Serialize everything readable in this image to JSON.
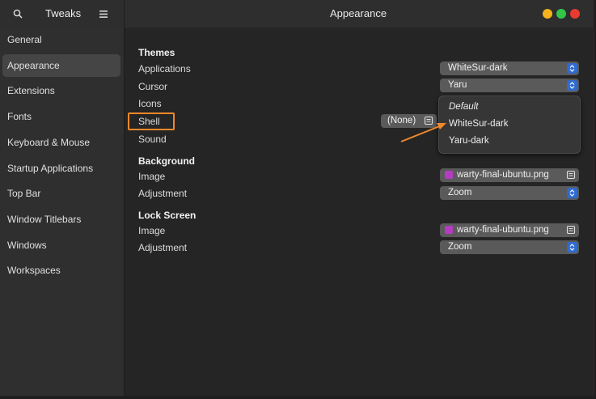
{
  "header": {
    "app_title": "Tweaks",
    "page_title": "Appearance",
    "window_controls": {
      "minimize_color": "#f5b31c",
      "maximize_color": "#33c748",
      "close_color": "#e93b30"
    }
  },
  "sidebar": {
    "items": [
      {
        "label": "General"
      },
      {
        "label": "Appearance",
        "active": true
      },
      {
        "label": "Extensions"
      },
      {
        "label": "Fonts"
      },
      {
        "label": "Keyboard & Mouse"
      },
      {
        "label": "Startup Applications"
      },
      {
        "label": "Top Bar"
      },
      {
        "label": "Window Titlebars"
      },
      {
        "label": "Windows"
      },
      {
        "label": "Workspaces"
      }
    ]
  },
  "themes": {
    "heading": "Themes",
    "applications": {
      "label": "Applications",
      "value": "WhiteSur-dark"
    },
    "cursor": {
      "label": "Cursor",
      "value": "Yaru"
    },
    "icons": {
      "label": "Icons"
    },
    "shell": {
      "label": "Shell",
      "value": "(None)"
    },
    "sound": {
      "label": "Sound"
    }
  },
  "icons_dropdown": {
    "options": [
      "Default",
      "WhiteSur-dark",
      "Yaru-dark"
    ]
  },
  "background": {
    "heading": "Background",
    "image": {
      "label": "Image",
      "value": "warty-final-ubuntu.png"
    },
    "adjustment": {
      "label": "Adjustment",
      "value": "Zoom"
    }
  },
  "lock_screen": {
    "heading": "Lock Screen",
    "image": {
      "label": "Image",
      "value": "warty-final-ubuntu.png"
    },
    "adjustment": {
      "label": "Adjustment",
      "value": "Zoom"
    }
  },
  "colors": {
    "accent": "#2f6bd1",
    "annotation": "#f0882a"
  }
}
